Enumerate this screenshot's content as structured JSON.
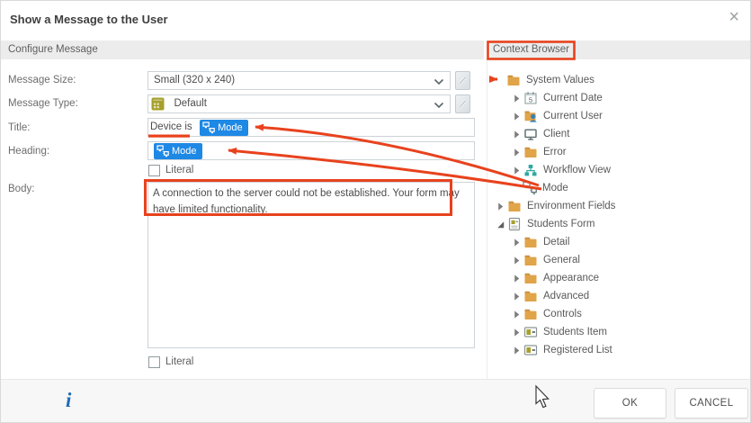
{
  "dialog": {
    "title": "Show a Message to the User",
    "close_glyph": "×"
  },
  "panels": {
    "left_header": "Configure Message",
    "right_header": "Context Browser"
  },
  "form": {
    "message_size": {
      "label": "Message Size:",
      "value": "Small (320 x 240)"
    },
    "message_type": {
      "label": "Message Type:",
      "value": "Default"
    },
    "title_field": {
      "label": "Title:",
      "text": "Device is",
      "chip": "Mode"
    },
    "heading_field": {
      "label": "Heading:",
      "chip": "Mode"
    },
    "literal_top": "Literal",
    "body_field": {
      "label": "Body:",
      "value": "A connection to the server could not be established. Your form may have limited functionality."
    },
    "literal_bottom": "Literal"
  },
  "tree": {
    "items": [
      {
        "label": "System Values",
        "icon": "folder-icon"
      },
      {
        "label": "Current Date",
        "icon": "calendar-icon"
      },
      {
        "label": "Current User",
        "icon": "user-folder-icon"
      },
      {
        "label": "Client",
        "icon": "monitor-icon"
      },
      {
        "label": "Error",
        "icon": "folder-icon"
      },
      {
        "label": "Workflow View",
        "icon": "workflow-icon"
      },
      {
        "label": "Mode",
        "icon": "mode-icon"
      },
      {
        "label": "Environment Fields",
        "icon": "folder-icon"
      },
      {
        "label": "Students Form",
        "icon": "form-icon"
      },
      {
        "label": "Detail",
        "icon": "folder-icon"
      },
      {
        "label": "General",
        "icon": "folder-icon"
      },
      {
        "label": "Appearance",
        "icon": "folder-icon"
      },
      {
        "label": "Advanced",
        "icon": "folder-icon"
      },
      {
        "label": "Controls",
        "icon": "folder-icon"
      },
      {
        "label": "Students Item",
        "icon": "list-item-icon"
      },
      {
        "label": "Registered List",
        "icon": "list-item-icon"
      }
    ]
  },
  "footer": {
    "ok": "OK",
    "cancel": "CANCEL",
    "info_glyph": "i"
  },
  "colors": {
    "accent_chip_blue": "#1e88e5",
    "annotation_red": "#e8421d",
    "folder_tan": "#e0a449",
    "olive": "#a6a02b",
    "teal": "#2fa8a2",
    "band_gray": "#ececec",
    "footer_gray": "#f7f7f7"
  }
}
